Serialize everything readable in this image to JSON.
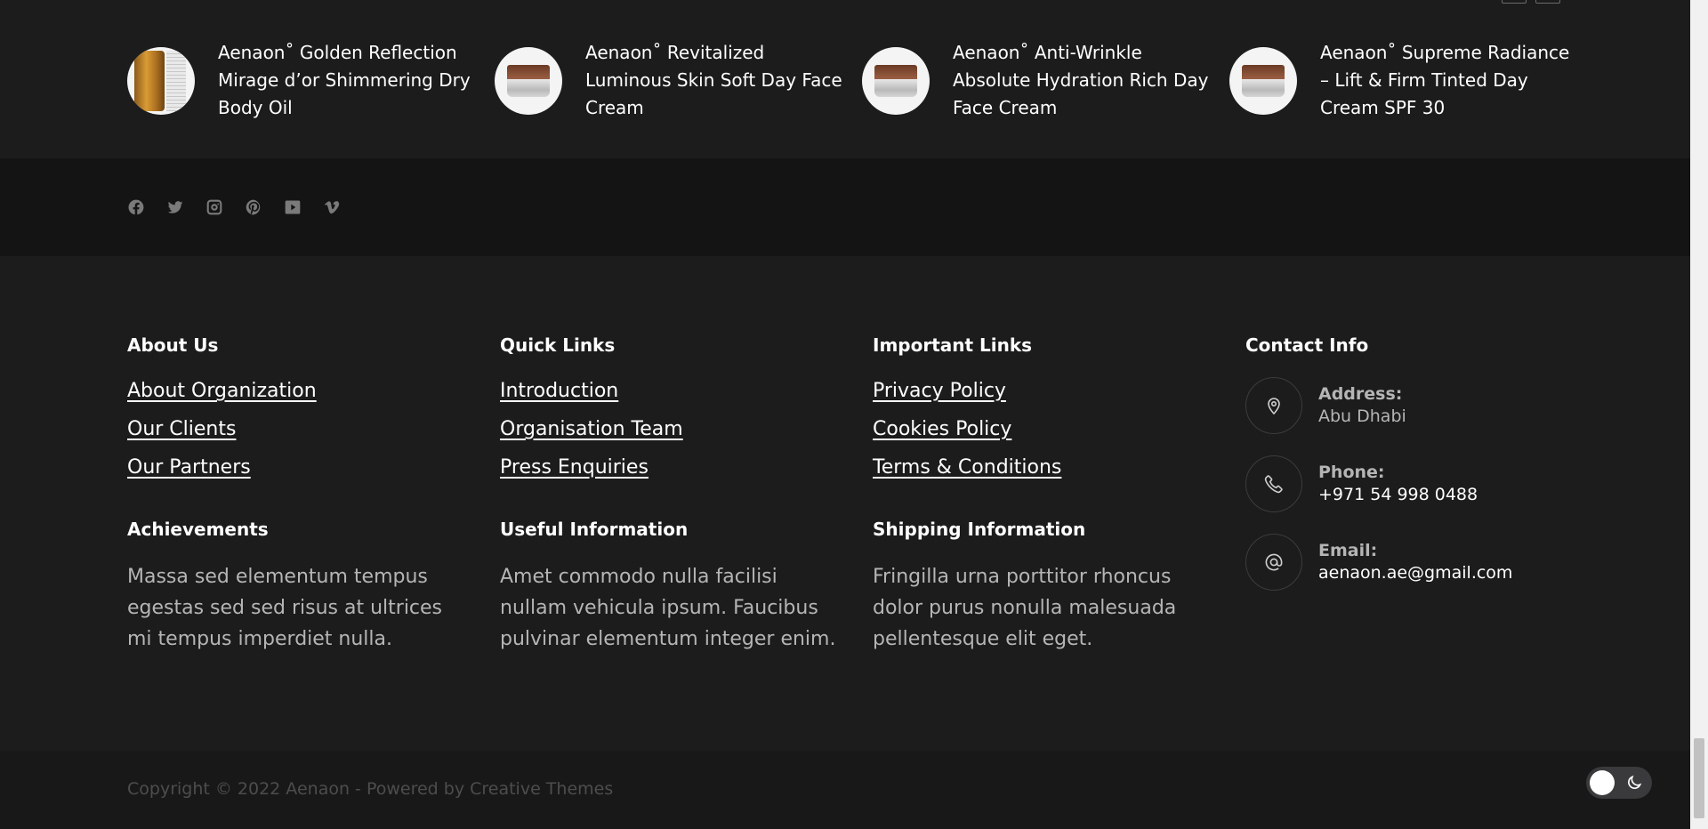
{
  "products": [
    {
      "title": "Aenaon˚ Golden Reflection Mirage d’or Shimmering Dry Body Oil",
      "thumb": "oil"
    },
    {
      "title": "Aenaon˚ Revitalized Luminous Skin Soft Day Face Cream",
      "thumb": "jar"
    },
    {
      "title": "Aenaon˚ Anti-Wrinkle Absolute Hydration Rich Day Face Cream",
      "thumb": "jar"
    },
    {
      "title": "Aenaon˚ Supreme Radiance – Lift & Firm Tinted Day Cream SPF 30",
      "thumb": "jar"
    }
  ],
  "social": [
    "facebook-icon",
    "twitter-icon",
    "instagram-icon",
    "pinterest-icon",
    "youtube-icon",
    "vimeo-icon"
  ],
  "footer": {
    "about": {
      "heading": "About Us",
      "links": [
        "About Organization",
        "Our Clients",
        "Our Partners"
      ]
    },
    "quick": {
      "heading": "Quick Links",
      "links": [
        "Introduction",
        "Organisation Team",
        "Press Enquiries"
      ]
    },
    "important": {
      "heading": "Important Links",
      "links": [
        "Privacy Policy",
        "Cookies Policy",
        "Terms & Conditions"
      ]
    },
    "achievements": {
      "heading": "Achievements",
      "text": "Massa sed elementum tempus egestas sed sed risus at ultrices mi tempus imperdiet nulla."
    },
    "useful": {
      "heading": "Useful Information",
      "text": "Amet commodo nulla facilisi nullam vehicula ipsum. Faucibus pulvinar elementum integer enim."
    },
    "shipping": {
      "heading": "Shipping Information",
      "text": "Fringilla urna porttitor rhoncus dolor purus nonulla malesuada pellentesque elit eget."
    },
    "contact": {
      "heading": "Contact Info",
      "address_label": "Address:",
      "address_value": "Abu Dhabi",
      "phone_label": "Phone:",
      "phone_value": "+971 54 998 0488",
      "email_label": "Email:",
      "email_value": "aenaon.ae@gmail.com"
    }
  },
  "copyright": "Copyright © 2022 Aenaon - Powered by Creative Themes"
}
